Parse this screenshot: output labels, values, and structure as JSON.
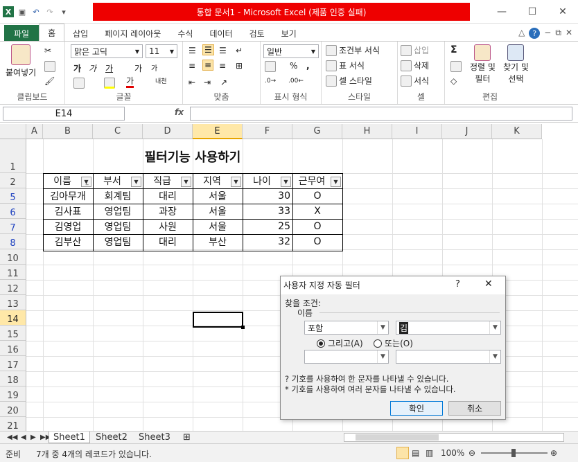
{
  "titlebar": {
    "title": "통합 문서1 - Microsoft Excel (제품 인증 실패)",
    "minimize": "—",
    "maximize": "☐",
    "close": "✕"
  },
  "ribbon_tabs": [
    "파일",
    "홈",
    "삽입",
    "페이지 레이아웃",
    "수식",
    "데이터",
    "검토",
    "보기"
  ],
  "ribbon": {
    "clipboard": {
      "label": "클립보드",
      "paste": "붙여넣기"
    },
    "font": {
      "label": "글꼴",
      "name": "맑은 고딕",
      "size": "11",
      "bold": "가",
      "italic": "가",
      "underline": "가",
      "grow": "가",
      "shrink": "가",
      "color": "가",
      "phonetic": "내천"
    },
    "align": {
      "label": "맞춤"
    },
    "number": {
      "label": "표시 형식",
      "format": "일반",
      "percent": "%",
      "comma": ","
    },
    "styles": {
      "label": "스타일",
      "conditional": "조건부 서식",
      "table": "표 서식",
      "cell": "셀 스타일"
    },
    "cells": {
      "label": "셀",
      "insert": "삽입",
      "delete": "삭제",
      "format": "서식"
    },
    "editing": {
      "label": "편집",
      "sum": "Σ",
      "sort1": "정렬 및",
      "sort2": "필터",
      "find1": "찾기 및",
      "find2": "선택"
    }
  },
  "formula_bar": {
    "name_box": "E14",
    "fx": "fx",
    "value": ""
  },
  "columns": [
    "A",
    "B",
    "C",
    "D",
    "E",
    "F",
    "G",
    "H",
    "I",
    "J",
    "K"
  ],
  "selected_column": "E",
  "rows": [
    "1",
    "2",
    "5",
    "6",
    "7",
    "8",
    "10",
    "11",
    "12",
    "13",
    "14",
    "15",
    "16",
    "17",
    "18",
    "19",
    "20",
    "21"
  ],
  "selected_row": "14",
  "sheet": {
    "title": "필터기능 사용하기",
    "headers": [
      "이름",
      "부서",
      "직급",
      "지역",
      "나이",
      "근무여"
    ],
    "records": [
      [
        "김아무개",
        "회계팀",
        "대리",
        "서울",
        "30",
        "O"
      ],
      [
        "김사표",
        "영업팀",
        "과장",
        "서울",
        "33",
        "X"
      ],
      [
        "김영업",
        "영업팀",
        "사원",
        "서울",
        "25",
        "O"
      ],
      [
        "김부산",
        "영업팀",
        "대리",
        "부산",
        "32",
        "O"
      ]
    ]
  },
  "sheet_tabs": [
    "Sheet1",
    "Sheet2",
    "Sheet3"
  ],
  "status": {
    "ready": "준비",
    "message": "7개 중 4개의 레코드가 있습니다.",
    "zoom": "100%"
  },
  "dialog": {
    "title": "사용자 지정 자동 필터",
    "help": "?",
    "close": "✕",
    "condition_label": "찾을 조건:",
    "field_label": "이름",
    "op1": "포함",
    "val1": "김",
    "and_label": "그리고(A)",
    "or_label": "또는(O)",
    "op2": "",
    "val2": "",
    "hint1": "? 기호를 사용하여 한 문자를 나타낼 수 있습니다.",
    "hint2": "* 기호를 사용하여 여러 문자를 나타낼 수 있습니다.",
    "ok": "확인",
    "cancel": "취소"
  }
}
